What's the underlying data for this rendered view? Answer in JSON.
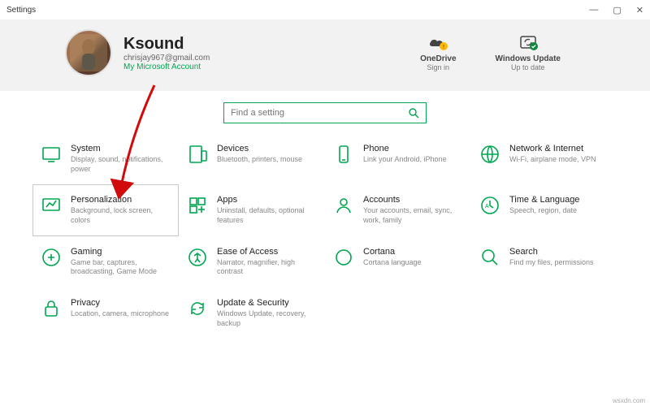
{
  "window": {
    "title": "Settings",
    "attribution": "wsxdn.com"
  },
  "user": {
    "name": "Ksound",
    "email": "chrisjay967@gmail.com",
    "msa": "My Microsoft Account"
  },
  "header_tiles": {
    "onedrive": {
      "label": "OneDrive",
      "sub": "Sign in"
    },
    "update": {
      "label": "Windows Update",
      "sub": "Up to date"
    }
  },
  "search": {
    "placeholder": "Find a setting"
  },
  "categories": [
    {
      "id": "system",
      "title": "System",
      "desc": "Display, sound, notifications, power"
    },
    {
      "id": "devices",
      "title": "Devices",
      "desc": "Bluetooth, printers, mouse"
    },
    {
      "id": "phone",
      "title": "Phone",
      "desc": "Link your Android, iPhone"
    },
    {
      "id": "network",
      "title": "Network & Internet",
      "desc": "Wi-Fi, airplane mode, VPN"
    },
    {
      "id": "personalization",
      "title": "Personalization",
      "desc": "Background, lock screen, colors"
    },
    {
      "id": "apps",
      "title": "Apps",
      "desc": "Uninstall, defaults, optional features"
    },
    {
      "id": "accounts",
      "title": "Accounts",
      "desc": "Your accounts, email, sync, work, family"
    },
    {
      "id": "time",
      "title": "Time & Language",
      "desc": "Speech, region, date"
    },
    {
      "id": "gaming",
      "title": "Gaming",
      "desc": "Game bar, captures, broadcasting, Game Mode"
    },
    {
      "id": "ease",
      "title": "Ease of Access",
      "desc": "Narrator, magnifier, high contrast"
    },
    {
      "id": "cortana",
      "title": "Cortana",
      "desc": "Cortana language"
    },
    {
      "id": "search",
      "title": "Search",
      "desc": "Find my files, permissions"
    },
    {
      "id": "privacy",
      "title": "Privacy",
      "desc": "Location, camera, microphone"
    },
    {
      "id": "update",
      "title": "Update & Security",
      "desc": "Windows Update, recovery, backup"
    }
  ],
  "colors": {
    "accent": "#00a650",
    "annotation": "#d10b0b"
  }
}
